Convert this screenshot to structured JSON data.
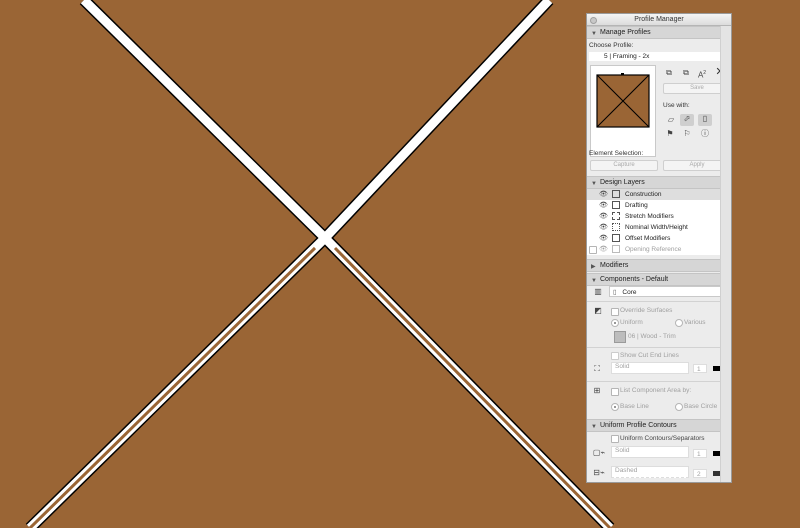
{
  "panel": {
    "title": "Profile Manager",
    "manage_profiles": "Manage Profiles",
    "choose_profile_label": "Choose Profile:",
    "profile_value": "5 | Framing - 2x",
    "save_label": "Save",
    "use_with_label": "Use with:",
    "element_selection_label": "Element Selection:",
    "capture_label": "Capture",
    "apply_label": "Apply",
    "design_layers": "Design Layers",
    "layers": [
      {
        "label": "Construction"
      },
      {
        "label": "Drafting"
      },
      {
        "label": "Stretch Modifiers"
      },
      {
        "label": "Nominal Width/Height"
      },
      {
        "label": "Offset Modifiers"
      },
      {
        "label": "Opening Reference"
      }
    ],
    "modifiers": "Modifiers",
    "components_header": "Components - Default",
    "component_value": "Core",
    "override_surfaces": "Override Surfaces",
    "uniform_label": "Uniform",
    "various_label": "Various",
    "surface_value": "06 | Wood - Trim",
    "show_cut_end_lines": "Show Cut End Lines",
    "solid_label": "Solid",
    "pen_value": "1",
    "list_component_area": "List Component Area by:",
    "base_line": "Base Line",
    "base_circle": "Base Circle",
    "uniform_profile_contours": "Uniform Profile Contours",
    "uniform_contours_separators": "Uniform Contours/Separators",
    "solid_label_2": "Solid",
    "pen_value_2": "1",
    "dashed_label": "Dashed",
    "pen_value_3": "2",
    "a_icon_text": "A",
    "a_icon_sup": "2",
    "core_icon_glyph": "▯"
  },
  "colors": {
    "canvas_bg": "#9a6535",
    "canvas_line": "#ffffff",
    "accent": "#3b7ce0"
  }
}
